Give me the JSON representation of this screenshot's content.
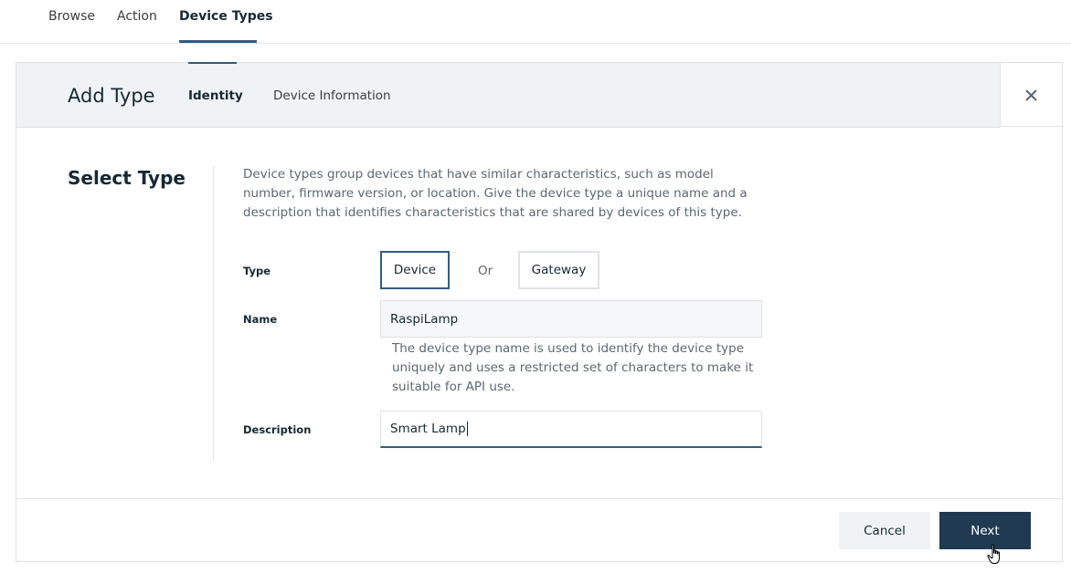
{
  "top_nav": {
    "tabs": [
      {
        "label": "Browse"
      },
      {
        "label": "Action"
      },
      {
        "label": "Device Types",
        "active": true
      }
    ]
  },
  "panel": {
    "title": "Add Type",
    "steps": [
      {
        "label": "Identity",
        "active": true
      },
      {
        "label": "Device Information"
      }
    ],
    "close_icon": "close-icon"
  },
  "form": {
    "section_title": "Select Type",
    "intro": "Device types group devices that have similar characteristics, such as model number, firmware version, or location. Give the device type a unique name and a description that identifies characteristics that are shared by devices of this type.",
    "type": {
      "label": "Type",
      "options": [
        "Device",
        "Gateway"
      ],
      "selected": "Device",
      "or_text": "Or"
    },
    "name": {
      "label": "Name",
      "value": "RaspiLamp",
      "helper": "The device type name is used to identify the device type uniquely and uses a restricted set of characters to make it suitable for API use."
    },
    "description": {
      "label": "Description",
      "value": "Smart Lamp"
    }
  },
  "footer": {
    "cancel_label": "Cancel",
    "next_label": "Next"
  },
  "colors": {
    "accent": "#325c80",
    "primary_button": "#1f3a52",
    "header_bg": "#eff3f5"
  }
}
